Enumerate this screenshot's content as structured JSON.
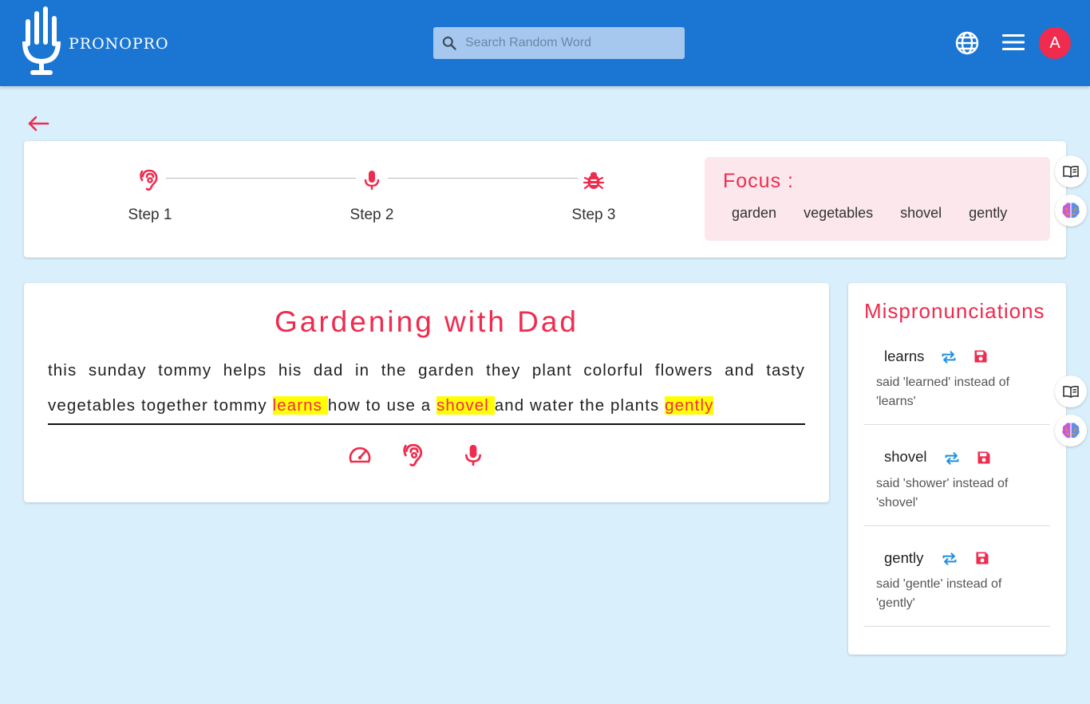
{
  "app": {
    "name": "PRONOPRO"
  },
  "search": {
    "placeholder": "Search Random Word"
  },
  "header": {
    "avatar_letter": "A"
  },
  "steps": [
    {
      "label": "Step 1",
      "icon": "hearing-icon"
    },
    {
      "label": "Step 2",
      "icon": "mic-icon"
    },
    {
      "label": "Step 3",
      "icon": "bug-icon"
    }
  ],
  "focus": {
    "title": "Focus :",
    "words": [
      "garden",
      "vegetables",
      "shovel",
      "gently"
    ]
  },
  "reading": {
    "title": "Gardening with Dad",
    "text_1": "this sunday tommy helps his dad in the garden they plant colorful flowers and tasty vegetables together tommy ",
    "hl_1": "learns ",
    "text_2": "how to use a ",
    "hl_2": "shovel ",
    "text_3": "and water the plants ",
    "hl_3": "gently"
  },
  "mispronunciations": {
    "title": "Mispronunciations",
    "items": [
      {
        "word": "learns",
        "description": "said 'learned' instead of 'learns'"
      },
      {
        "word": "shovel",
        "description": "said 'shower' instead of 'shovel'"
      },
      {
        "word": "gently",
        "description": "said 'gentle' instead of 'gently'"
      }
    ]
  },
  "colors": {
    "primary": "#1b76d3",
    "accent": "#ef2b4e",
    "background": "#d9effb",
    "focus_bg": "#fbe7ec",
    "highlight": "#ffff00",
    "repeat_icon": "#1b90e0"
  }
}
